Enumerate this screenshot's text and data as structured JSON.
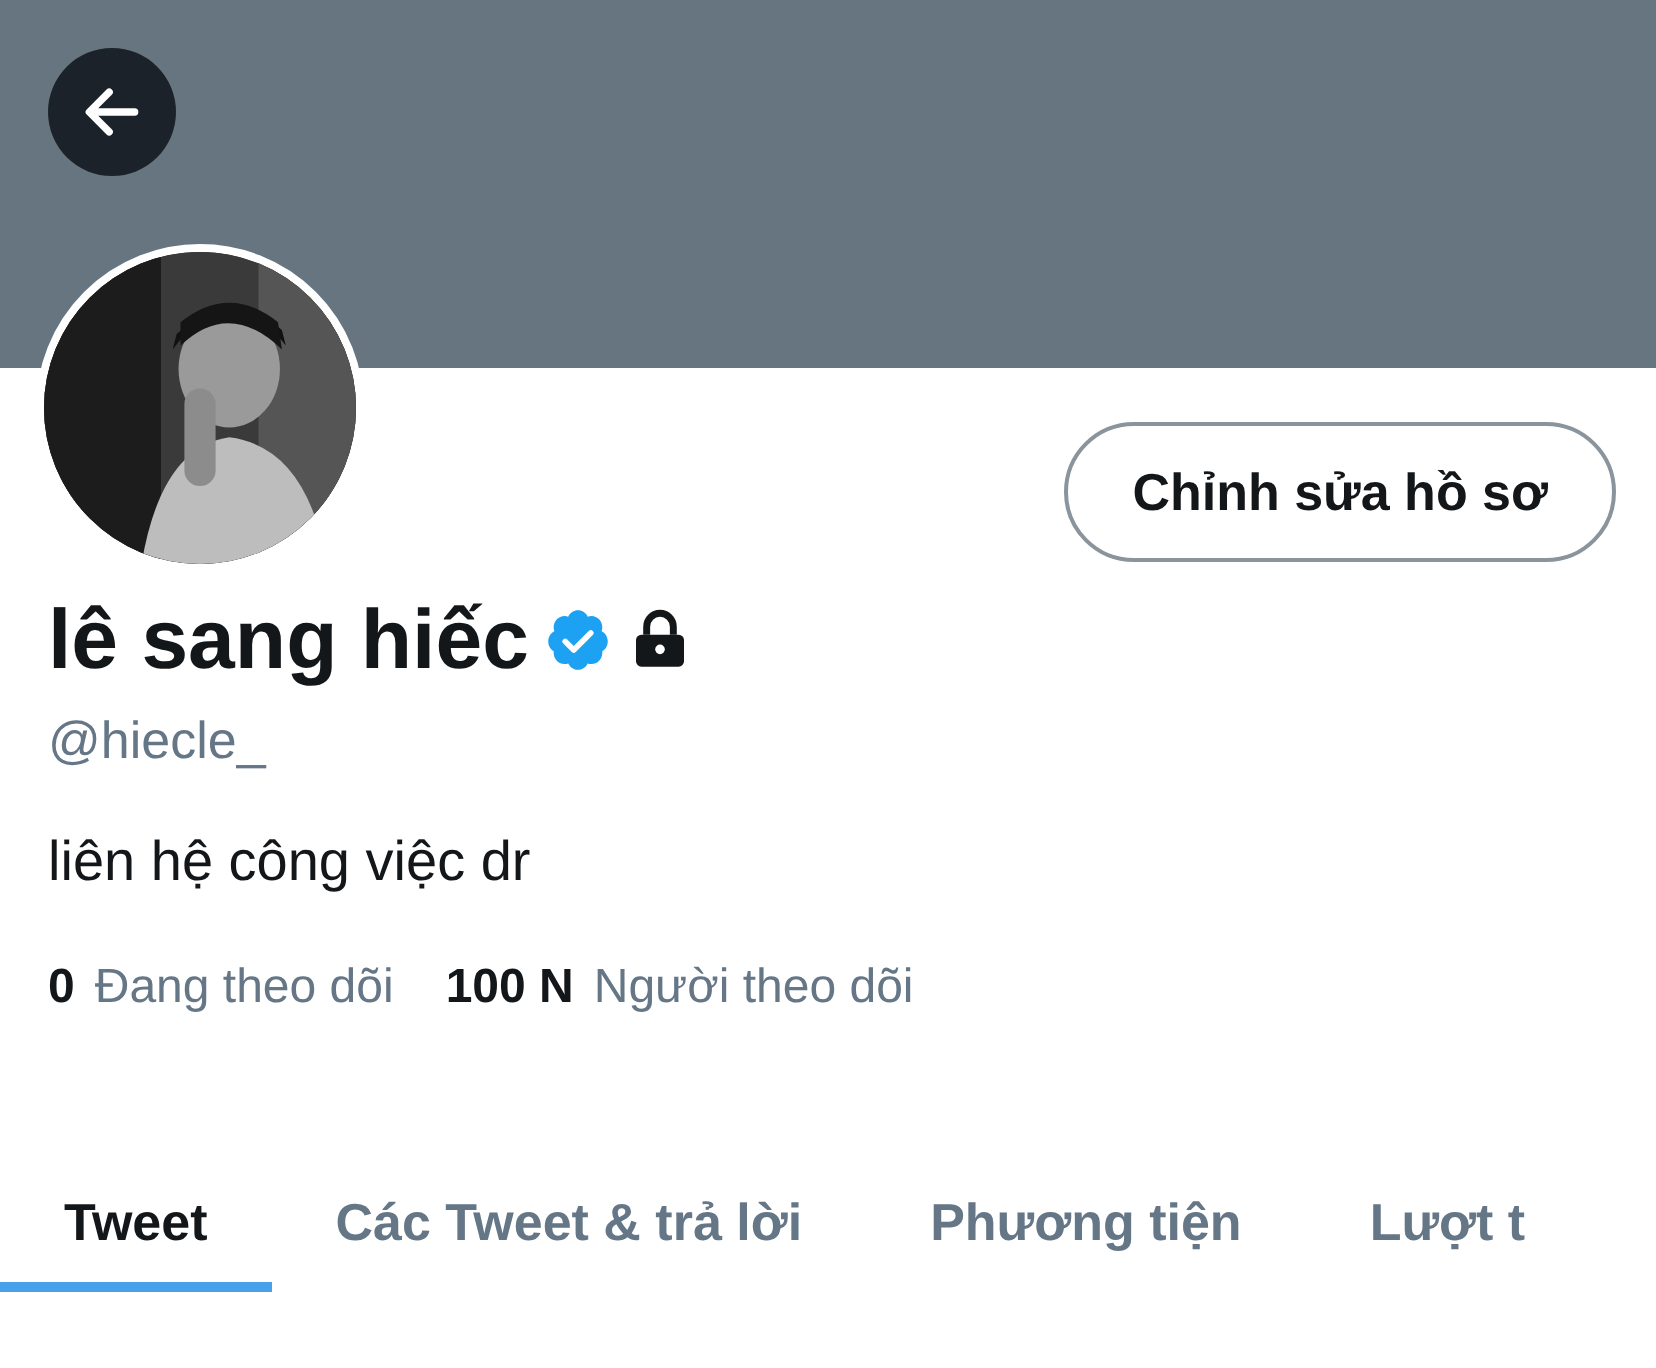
{
  "header": {
    "back_button": true
  },
  "edit_button": {
    "label": "Chỉnh sửa hồ sơ"
  },
  "profile": {
    "name": "lê sang hiếc",
    "verified": true,
    "protected": true,
    "handle": "@hiecle_",
    "bio": "liên hệ công việc dr"
  },
  "stats": [
    {
      "count": "0",
      "label": "Đang theo dõi"
    },
    {
      "count": "100 N",
      "label": "Người theo dõi"
    }
  ],
  "tabs": [
    {
      "label": "Tweet",
      "selected": true
    },
    {
      "label": "Các Tweet & trả lời",
      "selected": false
    },
    {
      "label": "Phương tiện",
      "selected": false
    },
    {
      "label": "Lượt t",
      "selected": false
    }
  ]
}
